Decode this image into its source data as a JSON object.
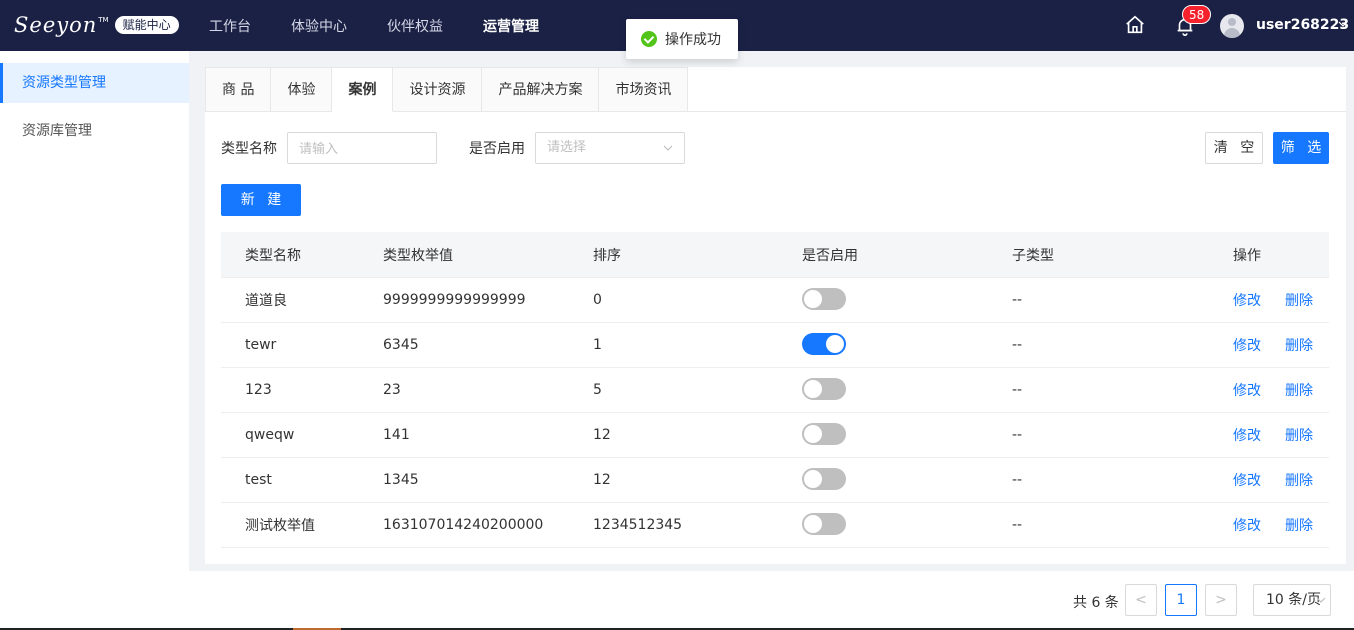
{
  "header": {
    "logo_text": "Seeyon",
    "logo_tm": "TM",
    "logo_badge": "赋能中心",
    "nav": [
      "工作台",
      "体验中心",
      "伙伴权益",
      "运营管理"
    ],
    "active_nav": "运营管理",
    "notification_count": "58",
    "username": "user268223"
  },
  "toast": {
    "text": "操作成功"
  },
  "sidebar": {
    "items": [
      {
        "label": "资源类型管理",
        "active": true
      },
      {
        "label": "资源库管理",
        "active": false
      }
    ]
  },
  "tabs": [
    "商 品",
    "体验",
    "案例",
    "设计资源",
    "产品解决方案",
    "市场资讯"
  ],
  "active_tab": "案例",
  "filters": {
    "type_name_label": "类型名称",
    "type_name_placeholder": "请输入",
    "enabled_label": "是否启用",
    "enabled_placeholder": "请选择",
    "clear_label": "清 空",
    "filter_label": "筛 选"
  },
  "new_button": "新 建",
  "table": {
    "headers": [
      "类型名称",
      "类型枚举值",
      "排序",
      "是否启用",
      "子类型",
      "操作"
    ],
    "edit_label": "修改",
    "delete_label": "删除",
    "rows": [
      {
        "name": "道道良",
        "enum": "9999999999999999",
        "order": "0",
        "enabled": false,
        "sub": "--"
      },
      {
        "name": "tewr",
        "enum": "6345",
        "order": "1",
        "enabled": true,
        "sub": "--"
      },
      {
        "name": "123",
        "enum": "23",
        "order": "5",
        "enabled": false,
        "sub": "--"
      },
      {
        "name": "qweqw",
        "enum": "141",
        "order": "12",
        "enabled": false,
        "sub": "--"
      },
      {
        "name": "test",
        "enum": "1345",
        "order": "12",
        "enabled": false,
        "sub": "--"
      },
      {
        "name": "测试枚举值",
        "enum": "163107014240200000",
        "order": "1234512345",
        "enabled": false,
        "sub": "--"
      }
    ]
  },
  "pagination": {
    "total": "共 6 条",
    "prev": "<",
    "current": "1",
    "next": ">",
    "page_size": "10 条/页"
  },
  "colors": {
    "primary": "#1677ff",
    "navbar": "#1b2145",
    "success": "#52c41a",
    "badge": "#f5222d"
  }
}
